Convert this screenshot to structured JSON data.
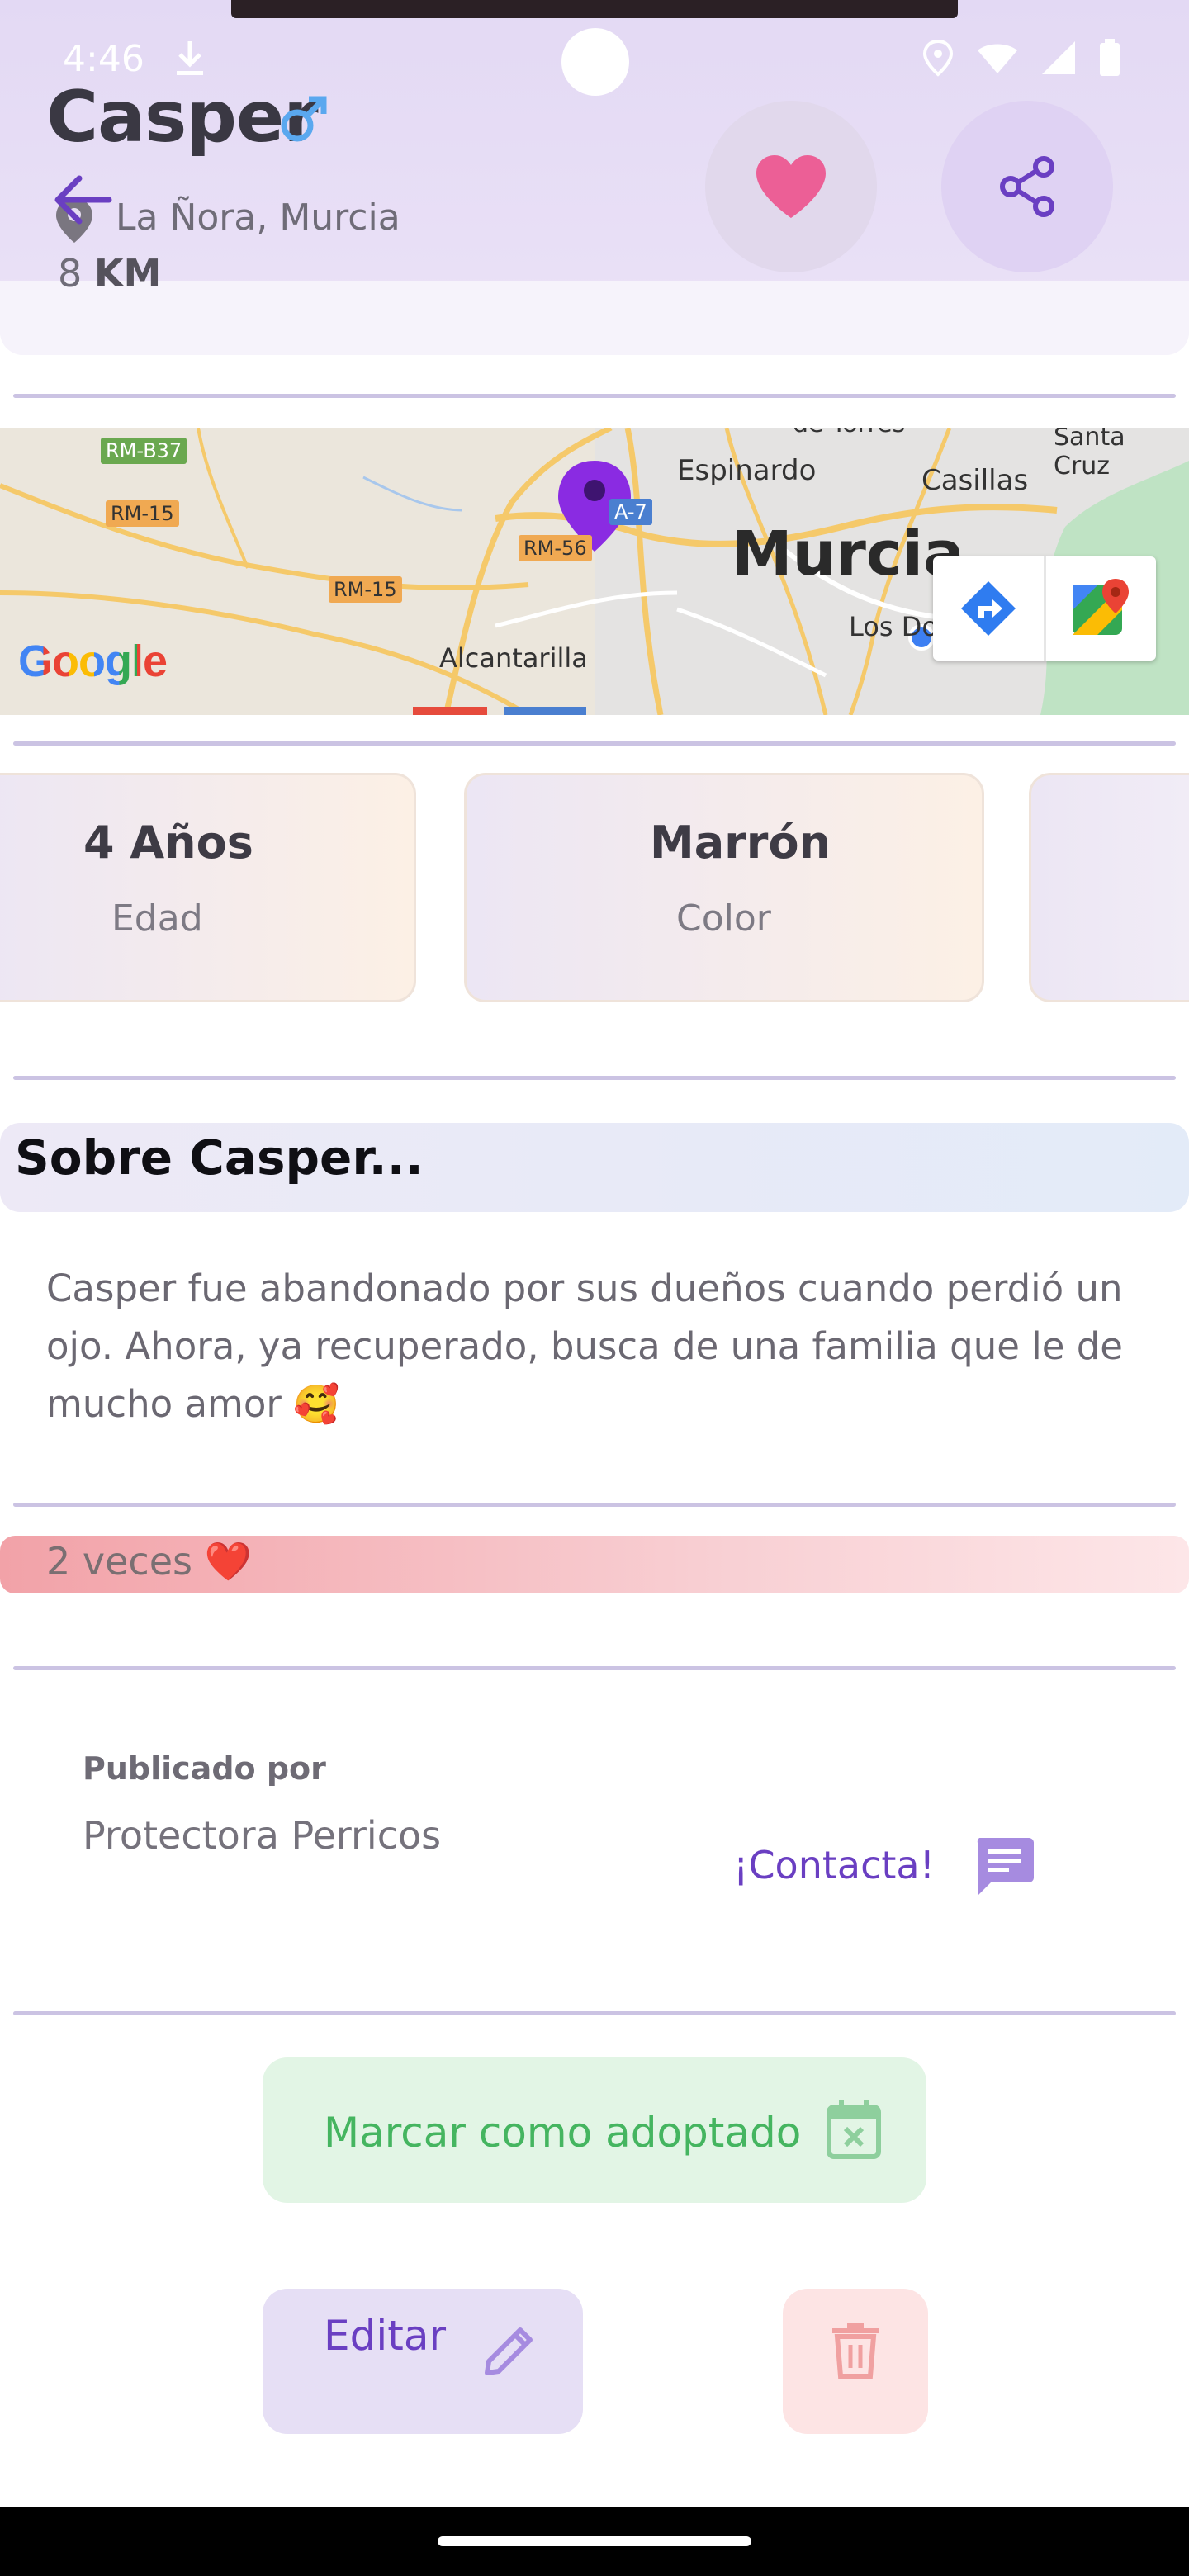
{
  "status_bar": {
    "time": "4:46"
  },
  "pet": {
    "name": "Casper",
    "location": "La Ñora, Murcia",
    "distance_value": "8",
    "distance_unit": "KM"
  },
  "map": {
    "google_logo": "Google",
    "labels": {
      "rm_b37": "RM-B37",
      "rm_15_a": "RM-15",
      "rm_15_b": "RM-15",
      "rm_56": "RM-56",
      "a7": "A-7",
      "espinardo": "Espinardo",
      "casillas": "Casillas",
      "santa_cruz": "Santa Cruz",
      "murcia": "Murcia",
      "los_dolores": "Los Dolores",
      "alcantarilla": "Alcantarilla",
      "torres": "de Torres"
    }
  },
  "info_cards": [
    {
      "value": "4 Años",
      "label": "Edad"
    },
    {
      "value": "Marrón",
      "label": "Color"
    },
    {
      "value": "",
      "label": ""
    }
  ],
  "about": {
    "title": "Sobre Casper...",
    "text": "Casper fue abandonado por sus dueños cuando perdió un ojo. Ahora, ya recuperado, busca de una familia que le de mucho amor 🥰"
  },
  "likes": {
    "text": "2 veces ❤️"
  },
  "publisher": {
    "label": "Publicado por",
    "name": "Protectora Perricos",
    "contact_label": "¡Contacta!"
  },
  "actions": {
    "adopt_label": "Marcar como adoptado",
    "edit_label": "Editar"
  },
  "colors": {
    "accent": "#6a3fc2",
    "heart": "#ec5f96",
    "adopt_green": "#45b560",
    "delete_red": "#f0a0a0"
  }
}
